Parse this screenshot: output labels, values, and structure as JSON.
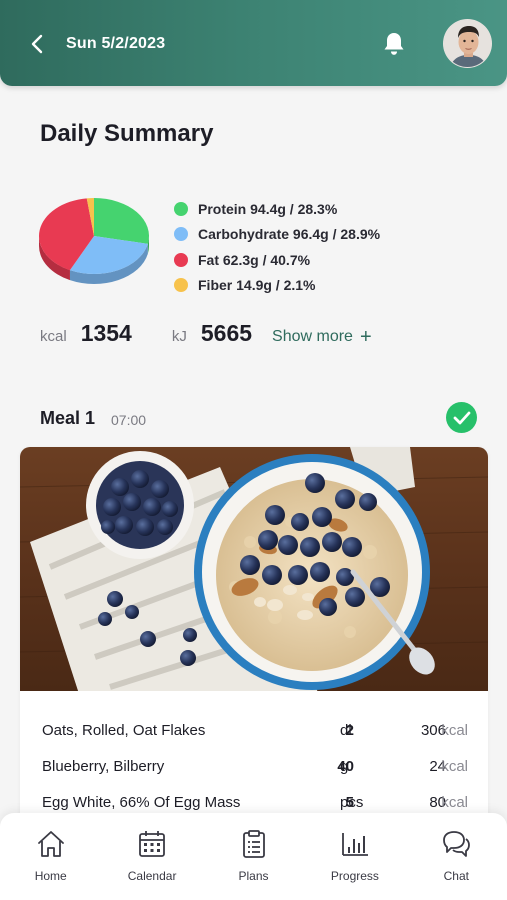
{
  "header": {
    "date": "Sun 5/2/2023",
    "colors": {
      "start": "#2f6b5d",
      "end": "#4a9585"
    }
  },
  "summary": {
    "title": "Daily Summary",
    "macros": [
      {
        "label": "Protein 94.4g / 28.3%",
        "color": "#45d36f",
        "percent": 28.3
      },
      {
        "label": "Carbohydrate 96.4g / 28.9%",
        "color": "#7fbdf7",
        "percent": 28.9
      },
      {
        "label": "Fat 62.3g / 40.7%",
        "color": "#e83a52",
        "percent": 40.7
      },
      {
        "label": "Fiber 14.9g / 2.1%",
        "color": "#f7c24c",
        "percent": 2.1
      }
    ],
    "kcal_label": "kcal",
    "kcal_value": "1354",
    "kj_label": "kJ",
    "kj_value": "5665",
    "show_more": "Show more",
    "show_more_icon": "plus-icon"
  },
  "meal": {
    "title": "Meal 1",
    "time": "07:00",
    "completed_icon": "check-icon",
    "photo_description_icon": "oatmeal-photo",
    "items": [
      {
        "name": "Oats, Rolled, Oat Flakes",
        "qty": "2",
        "unit": "dl",
        "kcal": "306",
        "kcal_unit": "kcal"
      },
      {
        "name": "Blueberry, Bilberry",
        "qty": "40",
        "unit": "g",
        "kcal": "24",
        "kcal_unit": "kcal"
      },
      {
        "name": "Egg White, 66% Of Egg Mass",
        "qty": "5",
        "unit": "pcs",
        "kcal": "80",
        "kcal_unit": "kcal"
      }
    ]
  },
  "nav": [
    {
      "label": "Home",
      "icon": "home-icon"
    },
    {
      "label": "Calendar",
      "icon": "calendar-icon"
    },
    {
      "label": "Plans",
      "icon": "clipboard-icon"
    },
    {
      "label": "Progress",
      "icon": "bar-chart-icon"
    },
    {
      "label": "Chat",
      "icon": "chat-icon"
    }
  ]
}
